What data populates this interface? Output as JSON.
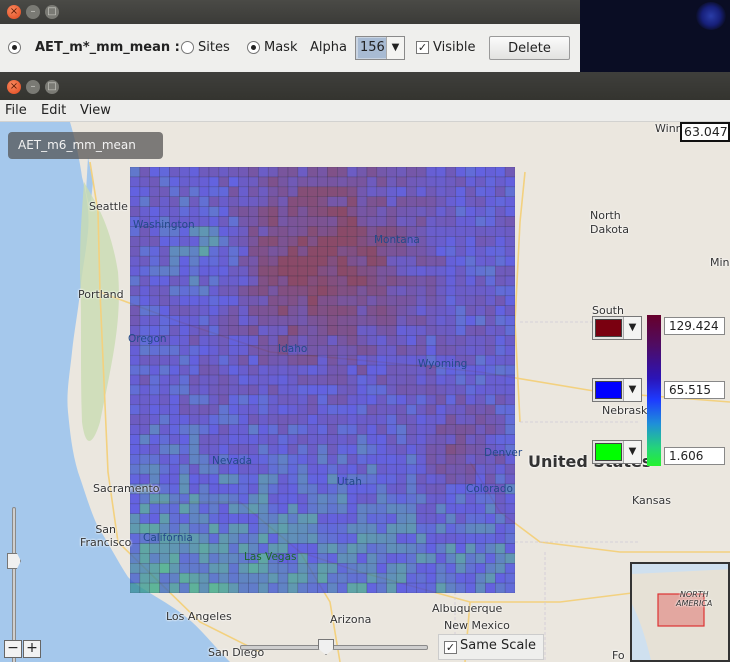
{
  "dialog": {
    "layer_name": "AET_m*_mm_mean :",
    "sites_label": "Sites",
    "mask_label": "Mask",
    "alpha_label": "Alpha",
    "alpha_value": "156",
    "visible_label": "Visible",
    "delete_label": "Delete",
    "visible_checked": true,
    "mode_selected": "Mask"
  },
  "window": {
    "menus": [
      "File",
      "Edit",
      "View"
    ]
  },
  "map": {
    "layer_label": "AET_m6_mm_mean",
    "hover_value": "63.047",
    "cities": {
      "seattle": "Seattle",
      "portland": "Portland",
      "sacramento": "Sacramento",
      "san_francisco": "San\nFrancisco",
      "los_angeles": "Los Angeles",
      "san_diego": "San Diego",
      "las_vegas": "Las Vegas",
      "denver": "Denver",
      "albuquerque": "Albuquerque",
      "kansas": "Kansas",
      "winnipeg": "Winn",
      "north_dakota": "North\nDakota",
      "south": "South",
      "nebraska": "Nebrask",
      "united_states": "United States",
      "min": "Min",
      "arizona": "Arizona",
      "new_mexico": "New Mexico",
      "fo": "Fo",
      "north_america": "NORTH\nAMERICA"
    },
    "states": {
      "washington": "Washington",
      "oregon": "Oregon",
      "idaho": "Idaho",
      "montana": "Montana",
      "wyoming": "Wyoming",
      "nevada": "Nevada",
      "utah": "Utah",
      "colorado": "Colorado",
      "california": "California"
    }
  },
  "legend": {
    "max_value": "129.424",
    "mid_value": "65.515",
    "min_value": "1.606",
    "max_color": "#7a0010",
    "mid_color": "#0000ff",
    "min_color": "#00ff00"
  },
  "controls": {
    "zoom_out": "−",
    "zoom_in": "+",
    "same_scale_label": "Same Scale",
    "same_scale_checked": true
  },
  "colors": {
    "high": "#6a1a3a",
    "mid": "#3b3bdc",
    "low": "#2fe04a"
  }
}
